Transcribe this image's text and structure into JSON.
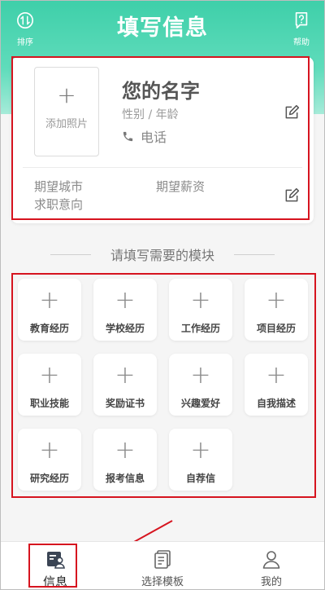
{
  "header": {
    "title": "填写信息",
    "left_label": "排序",
    "right_label": "帮助",
    "left_icon": "sort-icon",
    "right_icon": "help-icon",
    "accent": "#45d3ad"
  },
  "profile": {
    "photo_plus": "+",
    "photo_label": "添加照片",
    "name": "您的名字",
    "subtitle": "性别 / 年龄",
    "phone": "电话",
    "city": "期望城市",
    "salary": "期望薪资",
    "intent": "求职意向"
  },
  "modules": {
    "heading": "请填写需要的模块",
    "plus": "+",
    "items": [
      {
        "label": "教育经历"
      },
      {
        "label": "学校经历"
      },
      {
        "label": "工作经历"
      },
      {
        "label": "项目经历"
      },
      {
        "label": "职业技能"
      },
      {
        "label": "奖励证书"
      },
      {
        "label": "兴趣爱好"
      },
      {
        "label": "自我描述"
      },
      {
        "label": "研究经历"
      },
      {
        "label": "报考信息"
      },
      {
        "label": "自荐信"
      }
    ]
  },
  "tabbar": {
    "tabs": [
      {
        "label": "信息",
        "icon": "profile-card-icon",
        "active": true
      },
      {
        "label": "选择模板",
        "icon": "template-icon",
        "active": false
      },
      {
        "label": "我的",
        "icon": "user-icon",
        "active": false
      }
    ]
  },
  "annotations": {
    "highlight_color": "#d6141f"
  }
}
